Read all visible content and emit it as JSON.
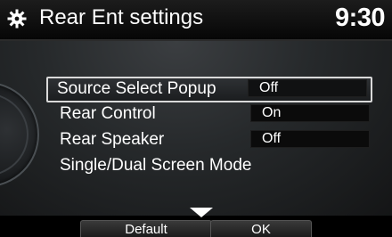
{
  "header": {
    "title": "Rear Ent settings",
    "clock": "9:30",
    "icon": "settings-gear-icon"
  },
  "menu": {
    "items": [
      {
        "label": "Source Select Popup",
        "value": "Off",
        "selected": true
      },
      {
        "label": "Rear Control",
        "value": "On"
      },
      {
        "label": "Rear Speaker",
        "value": "Off"
      },
      {
        "label": "Single/Dual Screen Mode"
      }
    ]
  },
  "footer": {
    "default_label": "Default",
    "ok_label": "OK"
  },
  "colors": {
    "background": "#000000",
    "panel": "#2a2d30",
    "text": "#ffffff",
    "selection_border": "#d9d9d9"
  }
}
